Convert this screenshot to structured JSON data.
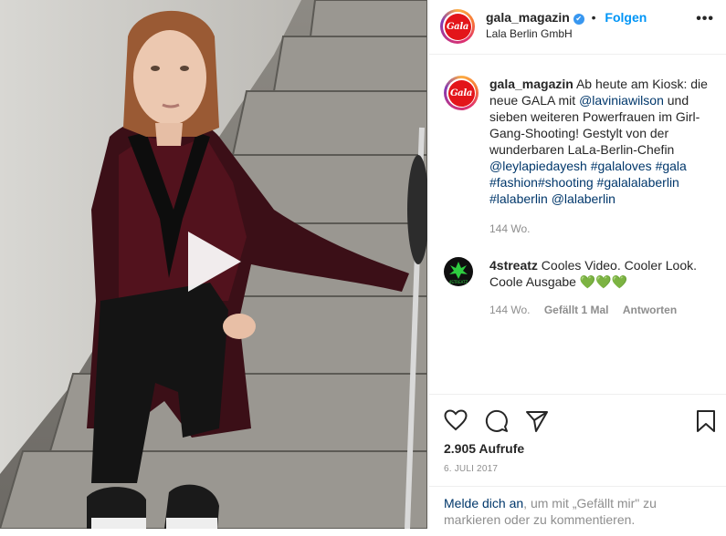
{
  "post": {
    "username": "gala_magazin",
    "verified_mark": "✔",
    "separator": "•",
    "follow_label": "Folgen",
    "location": "Lala Berlin GmbH",
    "more_icon": "•••",
    "avatar_logo_text": "Gala"
  },
  "caption": {
    "username": "gala_magazin",
    "text_part1": " Ab heute am Kiosk: die neue GALA mit ",
    "mention1": "@laviniawilson",
    "text_part2": " und sieben weiteren Powerfrauen im Girl-Gang-Shooting! Gestylt von der wunderbaren LaLa-Berlin-Chefin ",
    "mention2": "@leylapiedayesh",
    "text_part3": " ",
    "tag1": "#galaloves",
    "text_part4": " ",
    "tag2": "#gala",
    "text_part5": " ",
    "tag3": "#fashion",
    "tag4": "#shooting",
    "text_part6": " ",
    "tag5": "#galalalaberlin",
    "text_part7": " ",
    "tag6": "#lalaberlin",
    "text_part8": " ",
    "mention3": "@lalaberlin",
    "age": "144 Wo."
  },
  "comment": {
    "username": "4streatz",
    "text": " Cooles Video. Cooler Look. Coole Ausgabe ",
    "emojis": "💚💚💚",
    "age": "144 Wo.",
    "likes": "Gefällt 1 Mal",
    "reply": "Antworten",
    "avatar_text": "4STREATZ"
  },
  "actions": {
    "icons": [
      "heart-icon",
      "comment-icon",
      "share-icon",
      "bookmark-icon"
    ],
    "views": "2.905 Aufrufe",
    "date": "6. JULI 2017"
  },
  "login": {
    "link": "Melde dich an",
    "text": ", um mit „Gefällt mir\" zu markieren oder zu kommentieren."
  },
  "colors": {
    "link": "#00376b",
    "follow": "#0095f6",
    "muted": "#8e8e8e",
    "gala_red": "#e3151a"
  }
}
